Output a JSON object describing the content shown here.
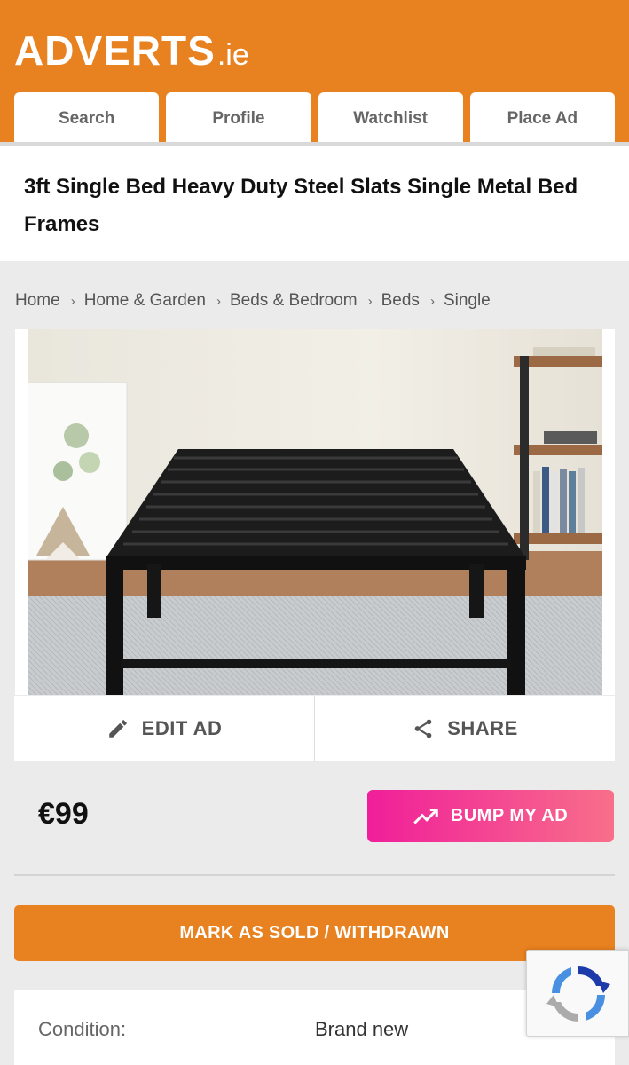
{
  "header": {
    "logo_main": "ADVERTS",
    "logo_tld": ".ie",
    "tabs": [
      "Search",
      "Profile",
      "Watchlist",
      "Place Ad"
    ]
  },
  "ad": {
    "title": "3ft Single Bed Heavy Duty Steel Slats Single Metal Bed Frames",
    "price": "€99",
    "condition_label": "Condition:",
    "condition_value": "Brand new"
  },
  "breadcrumb": [
    "Home",
    "Home & Garden",
    "Beds & Bedroom",
    "Beds",
    "Single"
  ],
  "actions": {
    "edit": "EDIT AD",
    "share": "SHARE",
    "bump": "BUMP MY AD",
    "mark_sold": "MARK AS SOLD / WITHDRAWN"
  },
  "colors": {
    "brand_orange": "#e8811f",
    "bump_pink": "#f01e9a"
  },
  "icons": {
    "edit": "pencil-icon",
    "share": "share-icon",
    "bump": "trending-up-icon",
    "recaptcha": "recaptcha-icon",
    "breadcrumb_separator": "chevron-right-icon"
  }
}
